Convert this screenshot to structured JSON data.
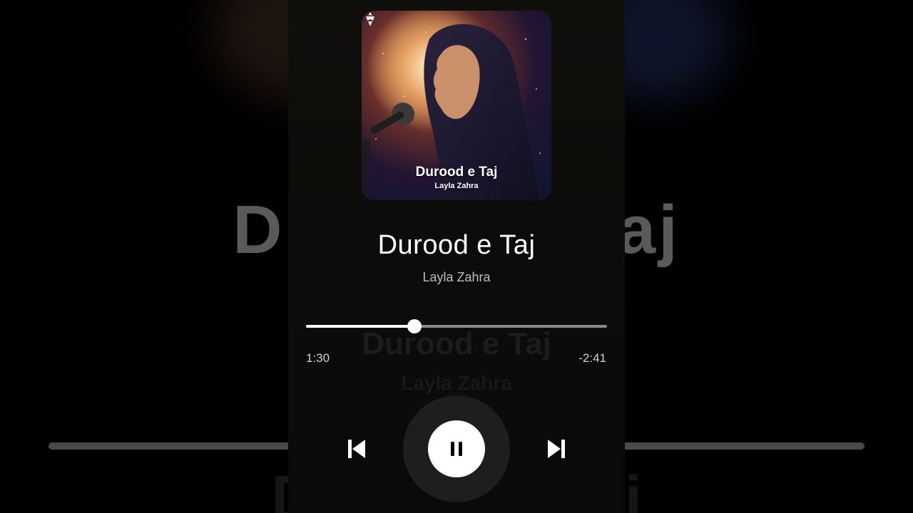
{
  "player": {
    "title": "Durood e Taj",
    "artist": "Layla Zahra",
    "elapsed": "1:30",
    "remaining": "-2:41",
    "progress_fraction": 0.36
  },
  "album_art": {
    "title": "Durood e Taj",
    "artist": "Layla Zahra"
  },
  "background": {
    "ghost_title": "Durood e Taj",
    "ghost_artist": "Layla Zahra"
  },
  "controls": {
    "previous_icon": "skip-previous-icon",
    "pause_icon": "pause-icon",
    "next_icon": "skip-next-icon"
  },
  "colors": {
    "accent": "#ffffff",
    "track": "#8a8a8a",
    "panel": "#0d0c0a",
    "background": "#000000"
  }
}
